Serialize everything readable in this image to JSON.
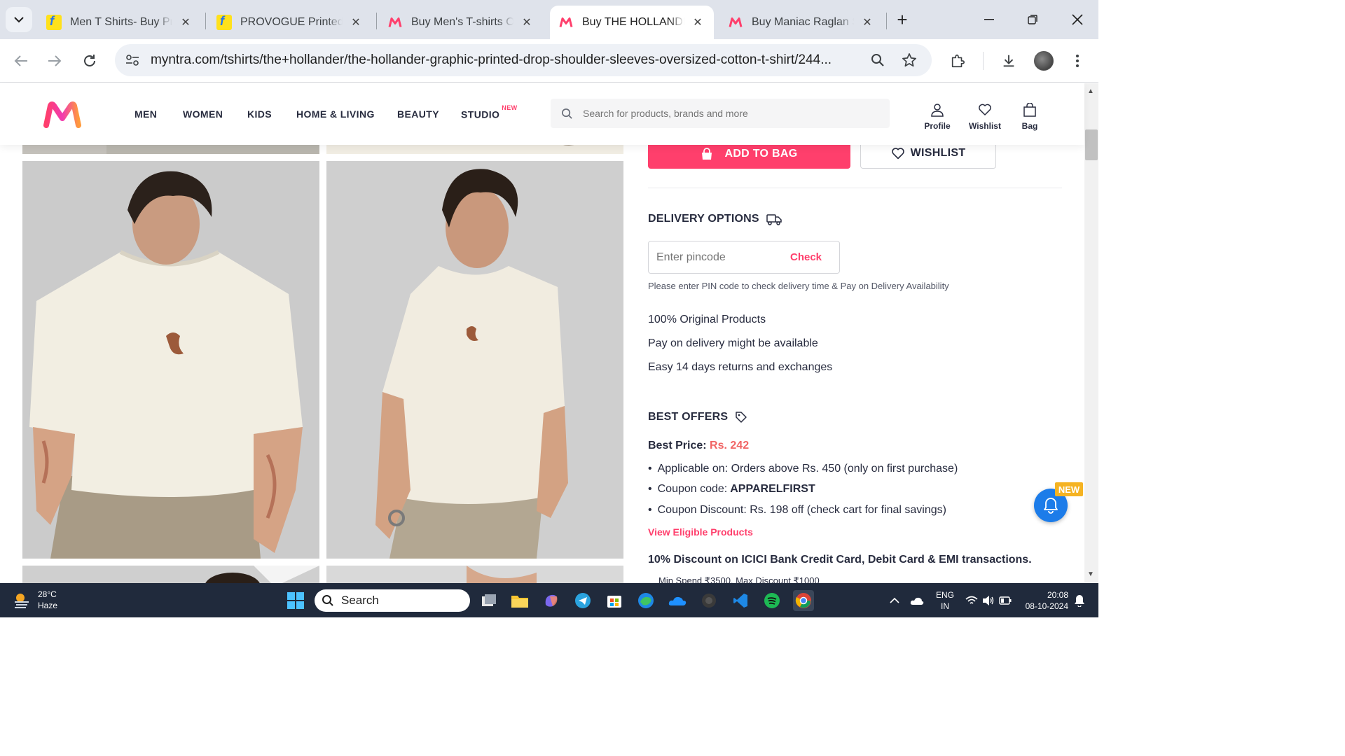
{
  "browser": {
    "tabs": [
      {
        "title": "Men T Shirts- Buy Printed, Striped",
        "favicon": "flipkart-favicon",
        "active": false
      },
      {
        "title": "PROVOGUE Printed Men Round Neck",
        "favicon": "flipkart-favicon",
        "active": false
      },
      {
        "title": "Buy Men's T-shirts Online",
        "favicon": "myntra-favicon",
        "active": false
      },
      {
        "title": "Buy THE HOLLANDER Graphic Printed",
        "favicon": "myntra-favicon",
        "active": true
      },
      {
        "title": "Buy Maniac Raglan Sleeves",
        "favicon": "myntra-favicon",
        "active": false
      }
    ],
    "new_tab_label": "+",
    "url": "myntra.com/tshirts/the+hollander/the-hollander-graphic-printed-drop-shoulder-sleeves-oversized-cotton-t-shirt/244..."
  },
  "header": {
    "nav": [
      "MEN",
      "WOMEN",
      "KIDS",
      "HOME & LIVING",
      "BEAUTY",
      "STUDIO"
    ],
    "studio_badge": "NEW",
    "search_placeholder": "Search for products, brands and more",
    "actions": [
      "Profile",
      "Wishlist",
      "Bag"
    ]
  },
  "product": {
    "add_to_bag": "ADD TO BAG",
    "wishlist": "WISHLIST",
    "delivery_title": "DELIVERY OPTIONS",
    "pincode_placeholder": "Enter pincode",
    "check_label": "Check",
    "pincode_note": "Please enter PIN code to check delivery time & Pay on Delivery Availability",
    "features": [
      "100% Original Products",
      "Pay on delivery might be available",
      "Easy 14 days returns and exchanges"
    ],
    "best_offers_title": "BEST OFFERS",
    "best_price_label": "Best Price:",
    "best_price_value": "Rs. 242",
    "offer_items": [
      {
        "text": "Applicable on: Orders above Rs. 450 (only on first purchase)",
        "bold": ""
      },
      {
        "text": "Coupon code:",
        "bold": "APPARELFIRST"
      },
      {
        "text": "Coupon Discount: Rs. 198 off (check cart for final savings)",
        "bold": ""
      }
    ],
    "view_eligible": "View Eligible Products",
    "bank_offer": "10% Discount on ICICI Bank Credit Card, Debit Card & EMI transactions.",
    "min_spend": "Min Spend ₹3500, Max Discount ₹1000"
  },
  "notification": {
    "badge": "NEW"
  },
  "taskbar": {
    "weather_temp": "28°C",
    "weather_desc": "Haze",
    "search_label": "Search",
    "lang_top": "ENG",
    "lang_bottom": "IN",
    "time": "20:08",
    "date": "08-10-2024"
  }
}
